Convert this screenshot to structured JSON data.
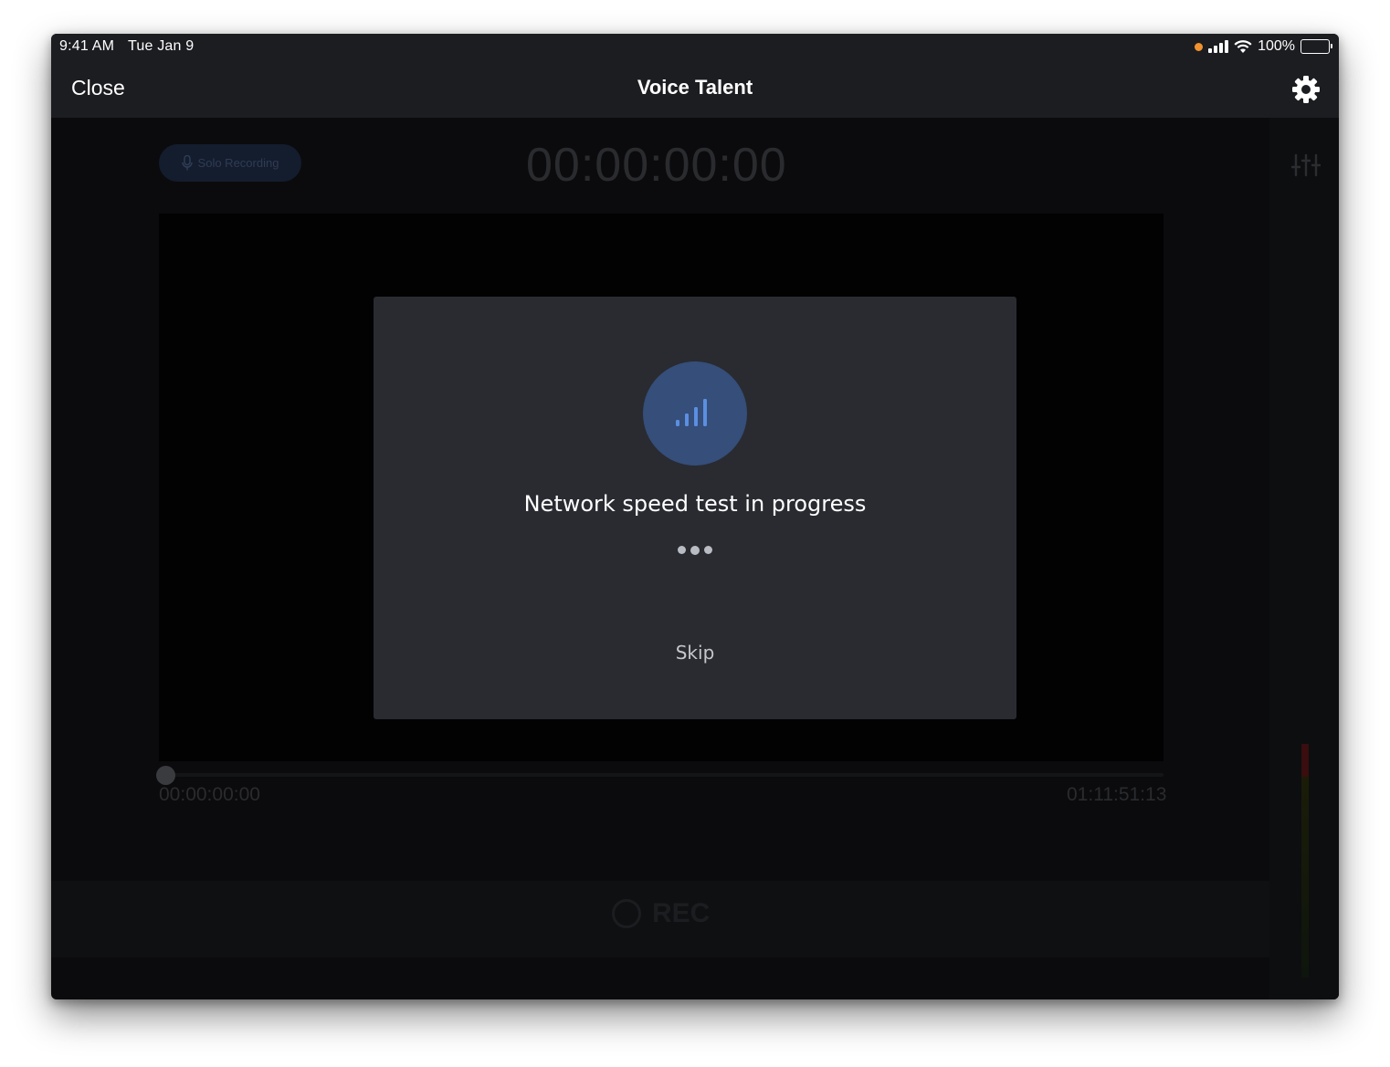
{
  "status_bar": {
    "time": "9:41 AM",
    "date": "Tue Jan 9",
    "battery": "100%"
  },
  "nav": {
    "close_label": "Close",
    "title": "Voice Talent"
  },
  "recorder": {
    "mode_label": "Solo Recording",
    "timecode": "00:00:00:00",
    "position": "00:00:00:00",
    "duration": "01:11:51:13",
    "rec_label": "REC"
  },
  "modal": {
    "title": "Network speed test in progress",
    "skip_label": "Skip"
  },
  "colors": {
    "accent": "#354e7a",
    "modal_bg": "#292b31",
    "signal_bars": "#5b8fe0",
    "record_indicator": "#f0922f"
  }
}
